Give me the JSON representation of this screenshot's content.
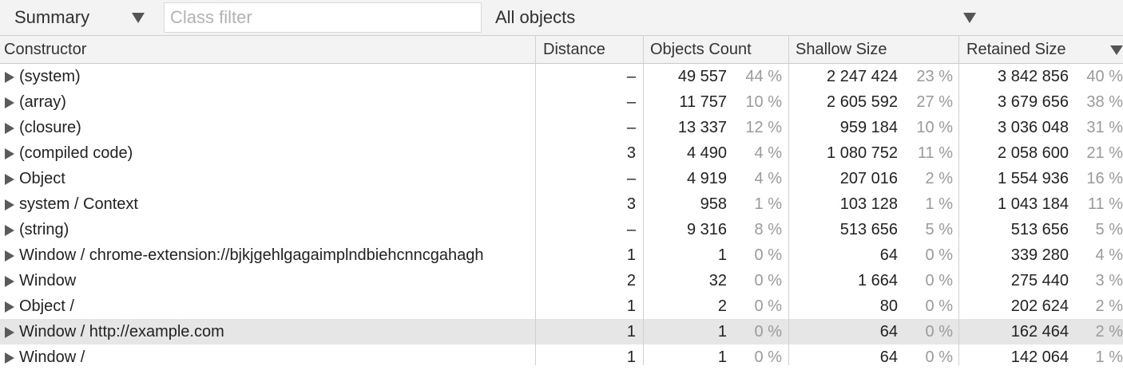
{
  "toolbar": {
    "view_select": "Summary",
    "class_filter_placeholder": "Class filter",
    "objects_select": "All objects"
  },
  "columns": {
    "constructor": "Constructor",
    "distance": "Distance",
    "objects_count": "Objects Count",
    "shallow_size": "Shallow Size",
    "retained_size": "Retained Size"
  },
  "sorted_column": "retained_size",
  "sort_direction": "descending",
  "rows": [
    {
      "name": "(system)",
      "distance": "–",
      "count": "49 557",
      "count_pct": "44 %",
      "shallow": "2 247 424",
      "shallow_pct": "23 %",
      "retained": "3 842 856",
      "retained_pct": "40 %"
    },
    {
      "name": "(array)",
      "distance": "–",
      "count": "11 757",
      "count_pct": "10 %",
      "shallow": "2 605 592",
      "shallow_pct": "27 %",
      "retained": "3 679 656",
      "retained_pct": "38 %"
    },
    {
      "name": "(closure)",
      "distance": "–",
      "count": "13 337",
      "count_pct": "12 %",
      "shallow": "959 184",
      "shallow_pct": "10 %",
      "retained": "3 036 048",
      "retained_pct": "31 %"
    },
    {
      "name": "(compiled code)",
      "distance": "3",
      "count": "4 490",
      "count_pct": "4 %",
      "shallow": "1 080 752",
      "shallow_pct": "11 %",
      "retained": "2 058 600",
      "retained_pct": "21 %"
    },
    {
      "name": "Object",
      "distance": "–",
      "count": "4 919",
      "count_pct": "4 %",
      "shallow": "207 016",
      "shallow_pct": "2 %",
      "retained": "1 554 936",
      "retained_pct": "16 %"
    },
    {
      "name": "system / Context",
      "distance": "3",
      "count": "958",
      "count_pct": "1 %",
      "shallow": "103 128",
      "shallow_pct": "1 %",
      "retained": "1 043 184",
      "retained_pct": "11 %"
    },
    {
      "name": "(string)",
      "distance": "–",
      "count": "9 316",
      "count_pct": "8 %",
      "shallow": "513 656",
      "shallow_pct": "5 %",
      "retained": "513 656",
      "retained_pct": "5 %"
    },
    {
      "name": "Window / chrome-extension://bjkjgehlgagaimplndbiehcnncgahagh",
      "distance": "1",
      "count": "1",
      "count_pct": "0 %",
      "shallow": "64",
      "shallow_pct": "0 %",
      "retained": "339 280",
      "retained_pct": "4 %"
    },
    {
      "name": "Window",
      "distance": "2",
      "count": "32",
      "count_pct": "0 %",
      "shallow": "1 664",
      "shallow_pct": "0 %",
      "retained": "275 440",
      "retained_pct": "3 %"
    },
    {
      "name": "Object /",
      "distance": "1",
      "count": "2",
      "count_pct": "0 %",
      "shallow": "80",
      "shallow_pct": "0 %",
      "retained": "202 624",
      "retained_pct": "2 %"
    },
    {
      "name": "Window / http://example.com",
      "distance": "1",
      "count": "1",
      "count_pct": "0 %",
      "shallow": "64",
      "shallow_pct": "0 %",
      "retained": "162 464",
      "retained_pct": "2 %",
      "selected": true
    },
    {
      "name": "Window /",
      "distance": "1",
      "count": "1",
      "count_pct": "0 %",
      "shallow": "64",
      "shallow_pct": "0 %",
      "retained": "142 064",
      "retained_pct": "1 %"
    }
  ]
}
